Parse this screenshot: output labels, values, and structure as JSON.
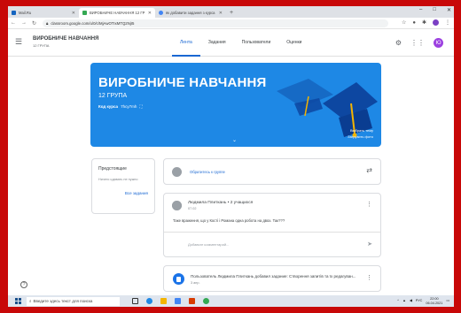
{
  "browser": {
    "tabs": [
      {
        "title": "Mail.Ru",
        "active": false,
        "color": "#1565c0"
      },
      {
        "title": "ВИРОБНИЧЕ НАВЧАННЯ 12 ГР",
        "active": true,
        "color": "#34a853"
      },
      {
        "title": "як добавити задання з курса",
        "active": false,
        "color": "#4285f4"
      }
    ],
    "new_tab": "+",
    "window_controls": [
      "–",
      "□",
      "✕"
    ],
    "url": "classroom.google.com/u/0/c/MjAwOTIxMTQ2NjI5"
  },
  "classroom": {
    "course_title": "ВИРОБНИЧЕ НАВЧАННЯ",
    "course_sub": "12 ГРУПА",
    "tabs": [
      "Лента",
      "Задания",
      "Пользователи",
      "Оценки"
    ],
    "active_tab": "Лента",
    "avatar_letter": "Ю",
    "accent": "#1967d2"
  },
  "banner": {
    "title": "ВИРОБНИЧЕ НАВЧАННЯ",
    "group": "12 ГРУПА",
    "code_label": "Код курса",
    "code_value": "7hcy7mh",
    "select_theme": "Выбрать тему",
    "upload_photo": "Загрузить фото",
    "color": "#1e88e5"
  },
  "upcoming": {
    "title": "Предстоящие",
    "subtitle": "Ничего сдавать не нужно",
    "link": "Все задания"
  },
  "stream": {
    "announce_placeholder": "Обратитесь к группе",
    "post": {
      "author": "Людмила Плиткань",
      "recipients": "•  2 учащихся",
      "date": "07.02",
      "body": "Таке враження, що у Кості і Романа одна робота на двох. Так???",
      "comment_placeholder": "Добавьте комментарий..."
    },
    "task": {
      "text": "Пользователь Людмила Плиткань добавил задание: Створення запитів та їх редагуван...",
      "date": "3 апр."
    }
  },
  "taskbar": {
    "search_placeholder": "Введите здесь текст для поиска",
    "lang": "РУС",
    "time": "22:00",
    "date": "06.04.2021"
  }
}
